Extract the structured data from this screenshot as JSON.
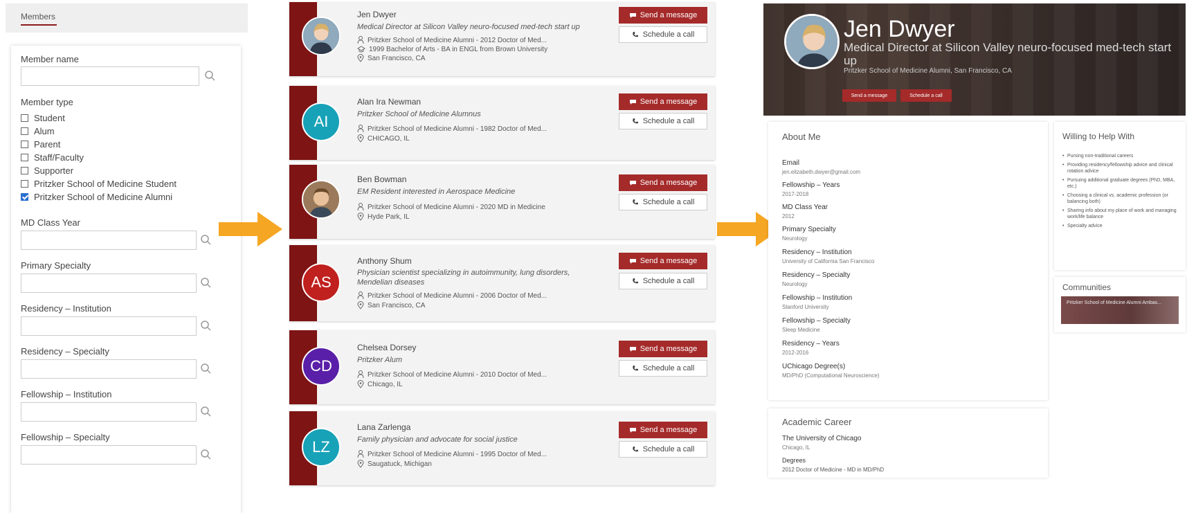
{
  "filters": {
    "tab_label": "Members",
    "member_name_label": "Member name",
    "member_type_label": "Member type",
    "member_types": [
      {
        "label": "Student",
        "checked": false
      },
      {
        "label": "Alum",
        "checked": false
      },
      {
        "label": "Parent",
        "checked": false
      },
      {
        "label": "Staff/Faculty",
        "checked": false
      },
      {
        "label": "Supporter",
        "checked": false
      },
      {
        "label": "Pritzker School of Medicine Student",
        "checked": false
      },
      {
        "label": "Pritzker School of Medicine Alumni",
        "checked": true
      }
    ],
    "md_class_year_label": "MD Class Year",
    "primary_specialty_label": "Primary Specialty",
    "residency_institution_label": "Residency – Institution",
    "residency_specialty_label": "Residency – Specialty",
    "fellowship_institution_label": "Fellowship – Institution",
    "fellowship_specialty_label": "Fellowship – Specialty"
  },
  "members": [
    {
      "name": "Jen Dwyer",
      "title": "Medical Director at Silicon Valley neuro-focused med-tech start up",
      "lines": [
        "Pritzker School of Medicine Alumni - 2012 Doctor of Med...",
        "1999 Bachelor of Arts - BA in ENGL from Brown University"
      ],
      "location": "San Francisco, CA",
      "initials": "",
      "avatar_color": "#6b8fa8",
      "message_label": "Send a message",
      "call_label": "Schedule a call"
    },
    {
      "name": "Alan Ira Newman",
      "title": "Pritzker School of Medicine Alumnus",
      "lines": [
        "Pritzker School of Medicine Alumni - 1982 Doctor of Med..."
      ],
      "location": "CHICAGO, IL",
      "initials": "AI",
      "avatar_color": "#17a2b8",
      "message_label": "Send a message",
      "call_label": "Schedule a call"
    },
    {
      "name": "Ben Bowman",
      "title": "EM Resident interested in Aerospace Medicine",
      "lines": [
        "Pritzker School of Medicine Alumni - 2020 MD in Medicine"
      ],
      "location": "Hyde Park, IL",
      "initials": "",
      "avatar_color": "#b08060",
      "message_label": "Send a message",
      "call_label": "Schedule a call"
    },
    {
      "name": "Anthony Shum",
      "title": "Physician scientist specializing in autoimmunity, lung disorders, Mendelian diseases",
      "lines": [
        "Pritzker School of Medicine Alumni - 2006 Doctor of Med..."
      ],
      "location": "San Francisco, CA",
      "initials": "AS",
      "avatar_color": "#c0201e",
      "message_label": "Send a message",
      "call_label": "Schedule a call"
    },
    {
      "name": "Chelsea Dorsey",
      "title": "Pritzker Alum",
      "lines": [
        "Pritzker School of Medicine Alumni - 2010 Doctor of Med..."
      ],
      "location": "Chicago, IL",
      "initials": "CD",
      "avatar_color": "#5a1fa8",
      "message_label": "Send a message",
      "call_label": "Schedule a call"
    },
    {
      "name": "Lana Zarlenga",
      "title": "Family physician and advocate for social justice",
      "lines": [
        "Pritzker School of Medicine Alumni - 1995 Doctor of Med..."
      ],
      "location": "Saugatuck, Michigan",
      "initials": "LZ",
      "avatar_color": "#17a2b8",
      "message_label": "Send a message",
      "call_label": "Schedule a call"
    }
  ],
  "profile": {
    "name": "Jen Dwyer",
    "title": "Medical Director at Silicon Valley neuro-focused med-tech start up",
    "school": "Pritzker School of Medicine Alumni, San Francisco, CA",
    "message_label": "Send a message",
    "call_label": "Schedule a call",
    "about_title": "About Me",
    "fields": [
      {
        "label": "Email",
        "value": "jen.elizabeth.dwyer@gmail.com"
      },
      {
        "label": "Fellowship – Years",
        "value": "2017-2018"
      },
      {
        "label": "MD Class Year",
        "value": "2012"
      },
      {
        "label": "Primary Specialty",
        "value": "Neurology"
      },
      {
        "label": "Residency – Institution",
        "value": "University of California San Francisco"
      },
      {
        "label": "Residency – Specialty",
        "value": "Neurology"
      },
      {
        "label": "Fellowship – Institution",
        "value": "Stanford University"
      },
      {
        "label": "Fellowship – Specialty",
        "value": "Sleep Medicine"
      },
      {
        "label": "Residency – Years",
        "value": "2012-2016"
      },
      {
        "label": "UChicago Degree(s)",
        "value": "MD/PhD (Computational Neuroscience)"
      }
    ],
    "career_title": "Academic Career",
    "career_institution": "The University of Chicago",
    "career_location": "Chicago, IL",
    "career_degrees_label": "Degrees",
    "career_degree": "2012 Doctor of Medicine - MD in MD/PhD",
    "willing_title": "Willing to Help With",
    "willing_items": [
      "Pursing non-traditional careers",
      "Providing residency/fellowship advice and clinical rotation advice",
      "Pursuing additional graduate degrees (PhD, MBA, etc.)",
      "Choosing a clinical vs. academic profession (or balancing both)",
      "Sharing info about my place of work and managing work/life balance",
      "Specialty advice"
    ],
    "communities_title": "Communities",
    "community_tile": "Pritzker School of Medicine Alumni Ambas..."
  },
  "colors": {
    "brand": "#7e1414",
    "button": "#a52a2a",
    "arrow": "#f5a623"
  }
}
